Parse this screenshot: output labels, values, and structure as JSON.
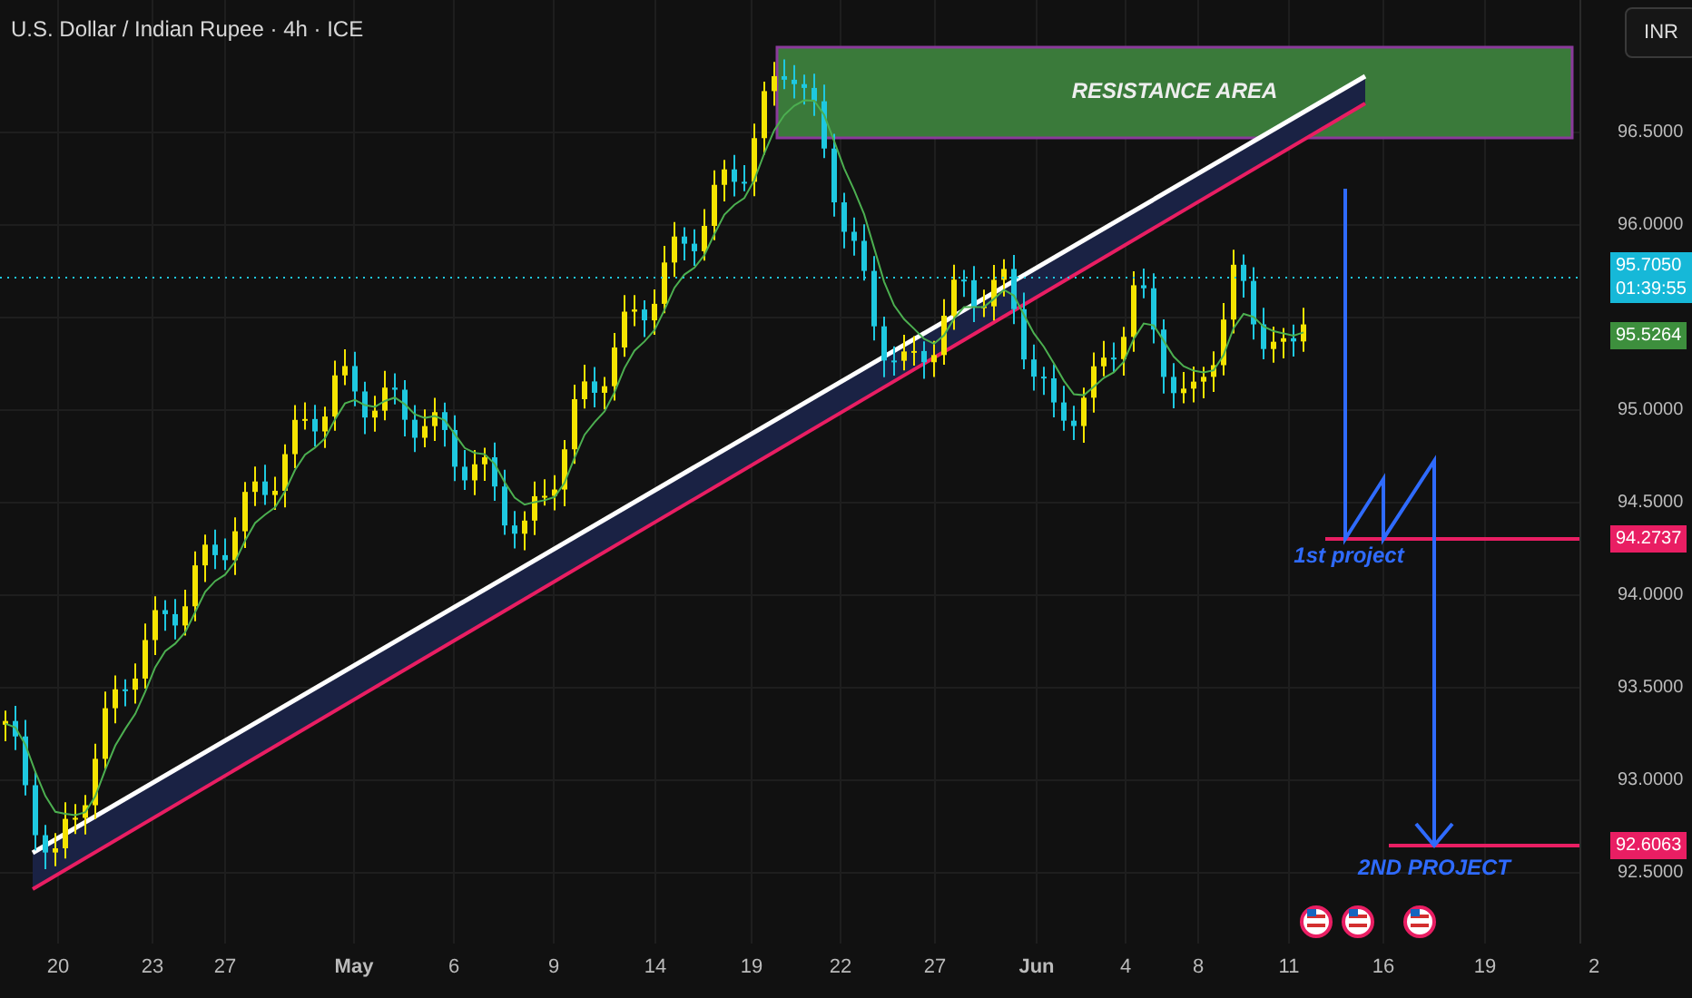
{
  "chart_title": "U.S. Dollar / Indian Rupee · 4h · ICE",
  "currency_button": "INR",
  "price_axis": [
    "96.5000",
    "96.0000",
    "95.0000",
    "94.5000",
    "94.0000",
    "93.5000",
    "93.0000",
    "92.5000"
  ],
  "time_axis": [
    "20",
    "23",
    "27",
    "May",
    "6",
    "9",
    "14",
    "19",
    "22",
    "27",
    "Jun",
    "4",
    "8",
    "11",
    "16",
    "19",
    "2"
  ],
  "price_tags": [
    {
      "kind": "last",
      "value": "95.7050",
      "countdown": "01:39:55"
    },
    {
      "kind": "average",
      "value": "95.5264"
    },
    {
      "kind": "target",
      "value": "94.2737"
    },
    {
      "kind": "target",
      "value": "92.6063"
    }
  ],
  "annotations": [
    {
      "kind": "zone",
      "text": "RESISTANCE AREA"
    },
    {
      "kind": "label",
      "text": "1st project"
    },
    {
      "kind": "label",
      "text": "2ND PROJECT"
    }
  ]
}
